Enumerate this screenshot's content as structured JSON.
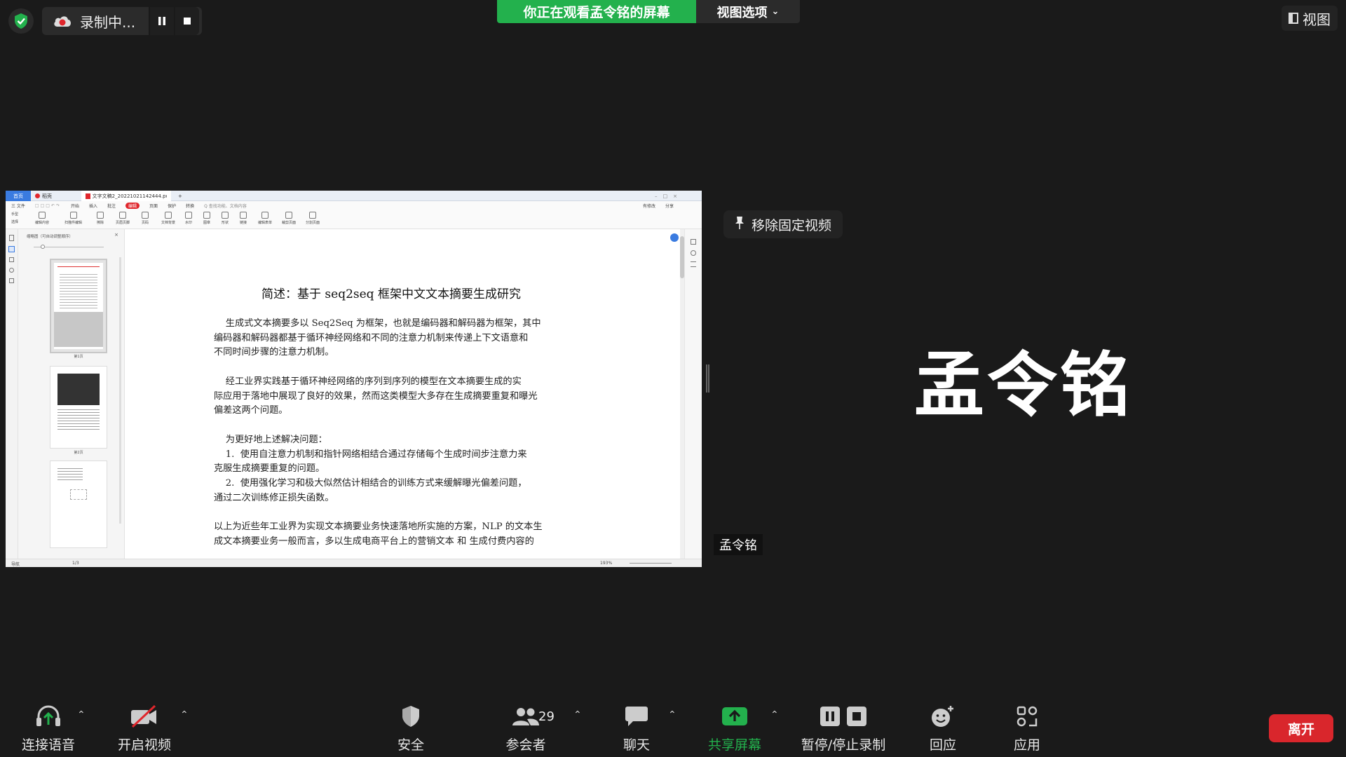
{
  "top": {
    "recording_label": "录制中...",
    "banner_text": "你正在观看孟令铭的屏幕",
    "view_options_label": "视图选项",
    "view_label": "视图"
  },
  "right_panel": {
    "unpin_label": "移除固定视频",
    "participant_big_name": "孟令铭",
    "participant_name_tag": "孟令铭"
  },
  "toolbar": {
    "items": [
      {
        "label": "连接语音"
      },
      {
        "label": "开启视频"
      },
      {
        "label": "安全"
      },
      {
        "label": "参会者",
        "count": "29"
      },
      {
        "label": "聊天"
      },
      {
        "label": "共享屏幕"
      },
      {
        "label": "暂停/停止录制"
      },
      {
        "label": "回应"
      },
      {
        "label": "应用"
      }
    ],
    "leave_label": "离开"
  },
  "pdf_app": {
    "tabs": [
      "首页",
      "稻壳",
      "文字文稿2_20221021142444.pdf",
      "+"
    ],
    "menu": [
      "三 文件",
      "开始",
      "插入",
      "批注",
      "编辑",
      "页面",
      "保护",
      "转换",
      "Q 查找功能、文档内容"
    ],
    "menu_right": [
      "有修改",
      "分享"
    ],
    "ribbon": [
      "手型",
      "选择",
      "编辑内容",
      "扫描件编辑",
      "擦除",
      "页眉页脚",
      "页码",
      "文档背景",
      "水印",
      "图章",
      "形状",
      "链接",
      "编辑表单",
      "裁剪页面",
      "分割页面"
    ],
    "thumb_panel_title": "缩略图（可自动调整顺序）",
    "thumb_labels": [
      "第1页",
      "第2页"
    ],
    "status": {
      "page": "1/3",
      "zoom": "193%",
      "nav_label": "导航"
    },
    "document": {
      "title": "简述：基于 seq2seq 框架中文文本摘要生成研究",
      "paragraphs": [
        "    生成式文本摘要多以 Seq2Seq 为框架，也就是编码器和解码器为框架，其中\n编码器和解码器都基于循环神经网络和不同的注意力机制来传递上下文语意和\n不同时间步骤的注意力机制。",
        "    经工业界实践基于循环神经网络的序列到序列的模型在文本摘要生成的实\n际应用于落地中展现了良好的效果，然而这类模型大多存在生成摘要重复和曝光\n偏差这两个问题。",
        "    为更好地上述解决问题：\n    1.  使用自注意力机制和指针网络相结合通过存储每个生成时间步注意力来\n克服生成摘要重复的问题。\n    2.  使用强化学习和极大似然估计相结合的训练方式来缓解曝光偏差问题，\n通过二次训练修正损失函数。",
        "以上为近些年工业界为实现文本摘要业务快速落地所实施的方案，NLP 的文本生\n成文本摘要业务一般而言，多以生成电商平台上的营销文本 和 生成付费内容的"
      ]
    }
  },
  "colors": {
    "background": "#1a1a1a",
    "banner_green": "#23b14d",
    "leave_red": "#d9262c",
    "share_green": "#23b14d"
  }
}
